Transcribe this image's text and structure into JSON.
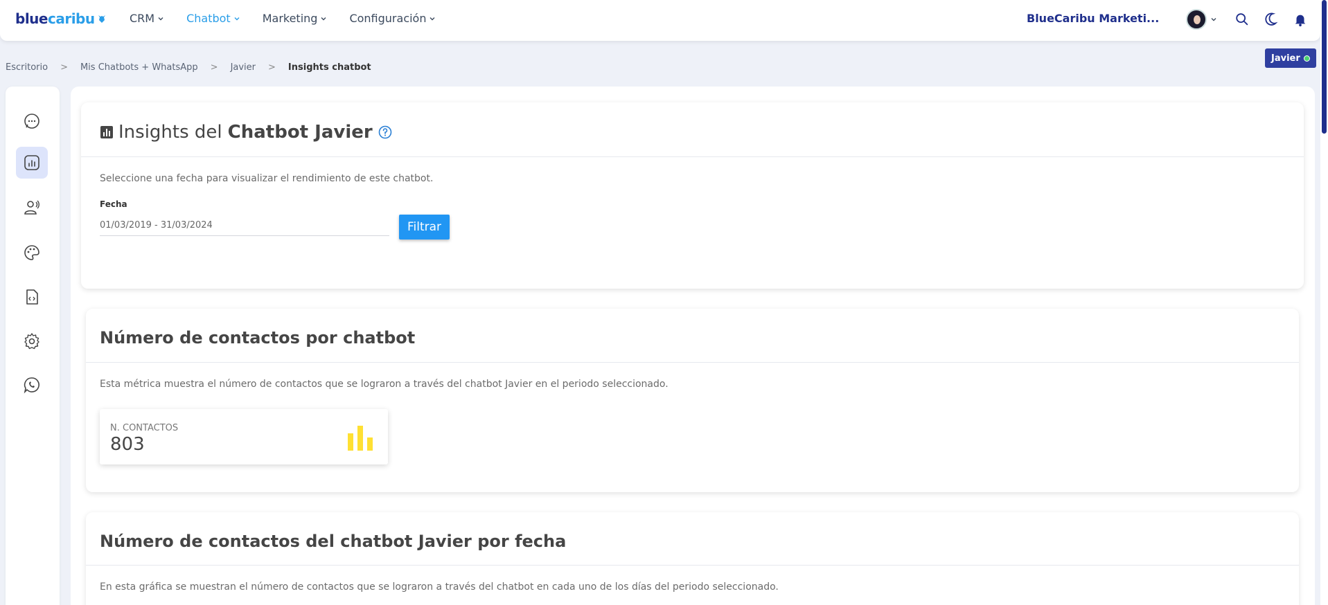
{
  "header": {
    "logo_blue": "blue",
    "logo_cyan": "caribu",
    "nav": [
      {
        "label": "CRM"
      },
      {
        "label": "Chatbot"
      },
      {
        "label": "Marketing"
      },
      {
        "label": "Configuración"
      }
    ],
    "company": "BlueCaribu Marketi..."
  },
  "breadcrumb": {
    "items": [
      "Escritorio",
      "Mis Chatbots + WhatsApp",
      "Javier",
      "Insights chatbot"
    ],
    "separator": ">"
  },
  "user_badge": "Javier",
  "sidebar": {
    "icons": [
      "chat-icon",
      "analytics-icon",
      "voice-user-icon",
      "palette-icon",
      "code-file-icon",
      "gear-icon",
      "whatsapp-icon"
    ]
  },
  "insights": {
    "title_prefix": "Insights del",
    "title_bold": "Chatbot Javier",
    "description": "Seleccione una fecha para visualizar el rendimiento de este chatbot.",
    "date_label": "Fecha",
    "date_value": "01/03/2019 - 31/03/2024",
    "filter_button": "Filtrar"
  },
  "contacts": {
    "title": "Número de contactos por chatbot",
    "description": "Esta métrica muestra el número de contactos que se lograron a través del chatbot Javier en el periodo seleccionado.",
    "metric_label": "N. CONTACTOS",
    "metric_value": "803"
  },
  "by_date": {
    "title": "Número de contactos del chatbot Javier por fecha",
    "description": "En esta gráfica se muestran el número de contactos que se lograron a través del chatbot en cada uno de los días del periodo seleccionado."
  },
  "colors": {
    "brand_navy": "#1f2f8c",
    "accent_blue": "#2196f3",
    "metric_yellow": "#ffe033"
  }
}
